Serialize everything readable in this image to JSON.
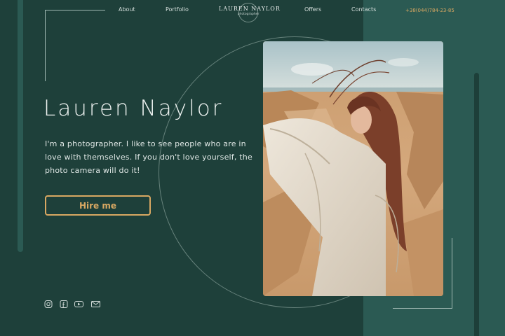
{
  "nav": {
    "about": "About",
    "portfolio": "Portfolio",
    "offers": "Offers",
    "contacts": "Contacts"
  },
  "logo": {
    "name": "LAUREN NAYLOR",
    "subtitle": "photographer"
  },
  "phone": "+38(044)784-23-85",
  "hero": {
    "name": "Lauren Naylor",
    "description": "I'm a photographer. I like to see people who are in love with themselves. If you don't love yourself, the photo camera will do it!",
    "cta": "Hire me"
  },
  "social": [
    "instagram-icon",
    "facebook-icon",
    "youtube-icon",
    "mail-icon"
  ],
  "colors": {
    "background": "#1e403a",
    "panel": "#2b5a53",
    "accent": "#d9a862",
    "text": "#edf2f0"
  }
}
